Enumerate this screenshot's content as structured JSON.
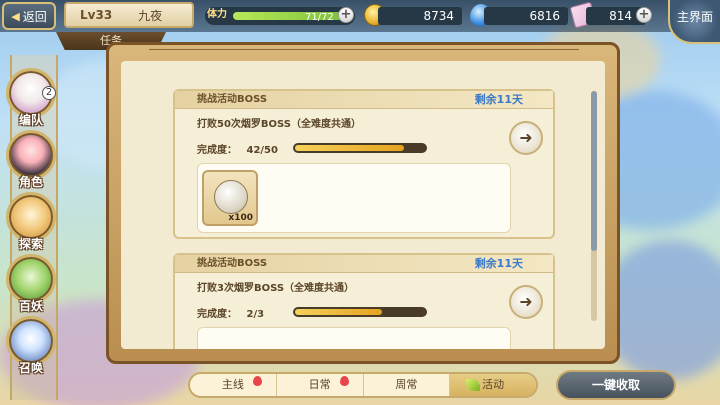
{
  "topbar": {
    "back_label": "返回",
    "level": "Lv33",
    "player_name": "九夜",
    "stamina_label": "体力",
    "stamina_value": "71/72",
    "stamina_fraction": 0.986,
    "coins": "8734",
    "gems": "6816",
    "tickets": "814",
    "home_label": "主界面",
    "subtab_label": "任务"
  },
  "sidebar": {
    "items": [
      {
        "label": "编队",
        "badge": "2"
      },
      {
        "label": "角色"
      },
      {
        "label": "探索"
      },
      {
        "label": "百妖"
      },
      {
        "label": "召唤"
      }
    ]
  },
  "quests": [
    {
      "category": "挑战活动BOSS",
      "remaining": "剩余11天",
      "title": "打败50次烟罗BOSS（全难度共通）",
      "progress_label": "完成度：",
      "progress_text": "42/50",
      "progress_fraction": 0.84,
      "reward_qty": "x100"
    },
    {
      "category": "挑战活动BOSS",
      "remaining": "剩余11天",
      "title": "打败3次烟罗BOSS（全难度共通）",
      "progress_label": "完成度：",
      "progress_text": "2/3",
      "progress_fraction": 0.667
    }
  ],
  "tabs": [
    {
      "label": "主线",
      "dot": true
    },
    {
      "label": "日常",
      "dot": true
    },
    {
      "label": "周常",
      "dot": false
    },
    {
      "label": "活动",
      "active": true
    }
  ],
  "claim_all_label": "一键收取",
  "colors": {
    "accent": "#3a7ac8",
    "progress": "#e6a21f",
    "frame": "#7a5427"
  }
}
